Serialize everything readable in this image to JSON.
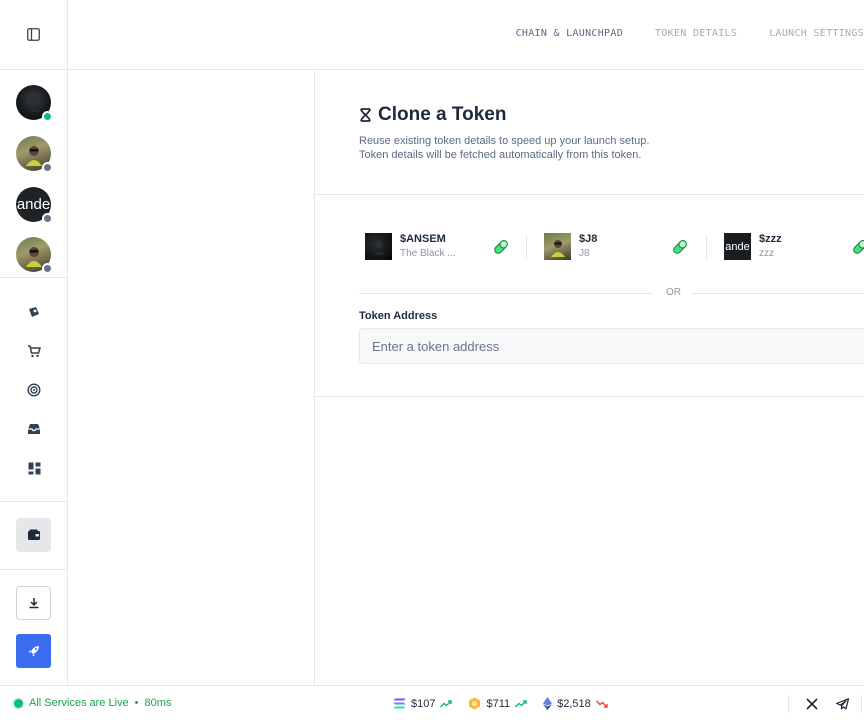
{
  "header": {
    "steps": [
      {
        "label": "CHAIN & LAUNCHPAD",
        "active": true
      },
      {
        "label": "TOKEN DETAILS",
        "active": false
      },
      {
        "label": "LAUNCH SETTINGS",
        "active": false
      }
    ]
  },
  "sidebar": {
    "avatars": [
      {
        "status": "online",
        "status_color": "#10b981"
      },
      {
        "status": "offline",
        "status_color": "#64748b"
      },
      {
        "text": "ande",
        "status": "offline",
        "status_color": "#64748b"
      },
      {
        "status": "offline",
        "status_color": "#64748b"
      }
    ],
    "nav_icons": [
      "tokens-icon",
      "cart-icon",
      "radar-icon",
      "inbox-icon",
      "dashboard-icon"
    ],
    "wallet_icon": "wallet-icon",
    "download_icon": "download-icon",
    "launch_icon": "rocket-icon",
    "launch_color": "#3b6df0"
  },
  "main": {
    "title": "Clone a Token",
    "desc_line1": "Reuse existing token details to speed up your launch setup.",
    "desc_line2": "Token details will be fetched automatically from this token.",
    "tokens": [
      {
        "symbol": "$ANSEM",
        "name": "The Black ..."
      },
      {
        "symbol": "$J8",
        "name": "J8"
      },
      {
        "symbol": "$zzz",
        "name": "zzz",
        "thumb_text": "ande"
      }
    ],
    "or_label": "OR",
    "address_label": "Token Address",
    "address_placeholder": "Enter a token address",
    "address_value": ""
  },
  "status": {
    "live_text": "All Services are Live",
    "latency": "80ms",
    "prices": [
      {
        "icon": "solana-icon",
        "value": "$107",
        "trend": "up"
      },
      {
        "icon": "bnb-icon",
        "value": "$711",
        "trend": "up"
      },
      {
        "icon": "ethereum-icon",
        "value": "$2,518",
        "trend": "down"
      }
    ],
    "colors": {
      "live": "#16a34a",
      "up": "#10b981",
      "down": "#ef4444"
    }
  }
}
